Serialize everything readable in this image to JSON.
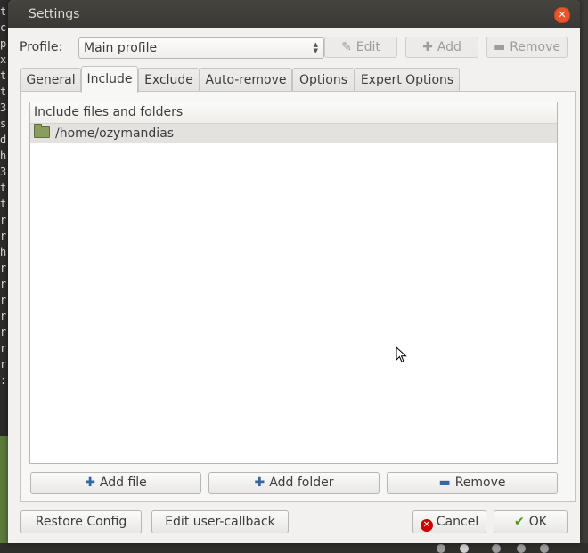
{
  "terminal": {
    "lines": [
      "t",
      "c",
      "p",
      "x",
      "t",
      "t",
      "3",
      "s",
      "d",
      "h",
      "3",
      "t",
      "t",
      "r",
      "r",
      "h",
      "r",
      "r",
      "r",
      "r",
      "r",
      "r",
      "r",
      ":"
    ]
  },
  "window": {
    "title": "Settings",
    "close_icon": "close-icon"
  },
  "profile": {
    "label": "Profile:",
    "selected": "Main profile",
    "edit_label": "Edit",
    "add_label": "Add",
    "remove_label": "Remove"
  },
  "tabs": [
    {
      "label": "General"
    },
    {
      "label": "Include"
    },
    {
      "label": "Exclude"
    },
    {
      "label": "Auto-remove"
    },
    {
      "label": "Options"
    },
    {
      "label": "Expert Options"
    }
  ],
  "active_tab": "Include",
  "include_list": {
    "header": "Include files and folders",
    "items": [
      {
        "path": "/home/ozymandias",
        "icon": "folder-icon"
      }
    ]
  },
  "list_actions": {
    "add_file": "Add file",
    "add_folder": "Add folder",
    "remove": "Remove"
  },
  "footer": {
    "restore_config": "Restore Config",
    "edit_callback": "Edit user-callback",
    "cancel": "Cancel",
    "ok": "OK"
  },
  "colors": {
    "titlebar": "#3c3b37",
    "close_button": "#e9542a",
    "selected_row": "#e3e2df",
    "add_icon": "#3465a4",
    "remove_icon": "#3465a4",
    "ok_check": "#4e9a06",
    "cancel_icon": "#cc0000"
  }
}
